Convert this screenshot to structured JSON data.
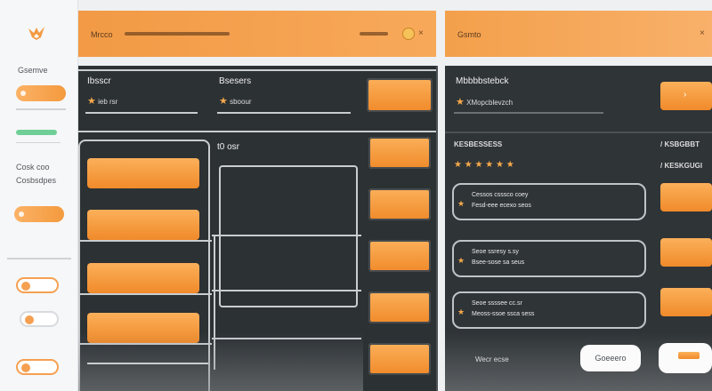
{
  "colors": {
    "accent": "#f39a43",
    "panel": "#2c3134",
    "sidebar": "#f6f7f8",
    "success": "#6fcf97"
  },
  "icons": {
    "logo": "fox-logo-icon",
    "star": "star-icon"
  },
  "sidebar": {
    "item_1": "Gsemve",
    "item_2": "Cosk coo",
    "item_3": "Cosbsdpes"
  },
  "header_left": {
    "title": "Mrcco"
  },
  "header_right": {
    "title": "Gsmto"
  },
  "left_panel": {
    "col1_title": "Ibsscr",
    "col1_sub": "ieb rsr",
    "col2_title": "Bsesers",
    "col2_sub": "sboour",
    "section_label": "t0 osr",
    "star_glyph": "★"
  },
  "right_panel": {
    "title": "Mbbbbstebck",
    "sub": "XMopcblevzch",
    "section_left": "KESBESSESS",
    "section_right_1": "/ KSBGBBT",
    "section_right_2": "/ KESKGUGI",
    "star_row": "★ ★ ★ ★ ★ ★",
    "items": [
      {
        "line1": "Cessos csssco coey",
        "line2": "Fesd-eee ecexo seos"
      },
      {
        "line1": "Seoe ssresy s.sy",
        "line2": "Bsee-sose sa seus"
      },
      {
        "line1": "Seoe ssssee cc.sr",
        "line2": "Meoss-ssoe ssca sess"
      }
    ],
    "bottom_text": "Wecr ecse",
    "bottom_button": "Goeeero"
  }
}
